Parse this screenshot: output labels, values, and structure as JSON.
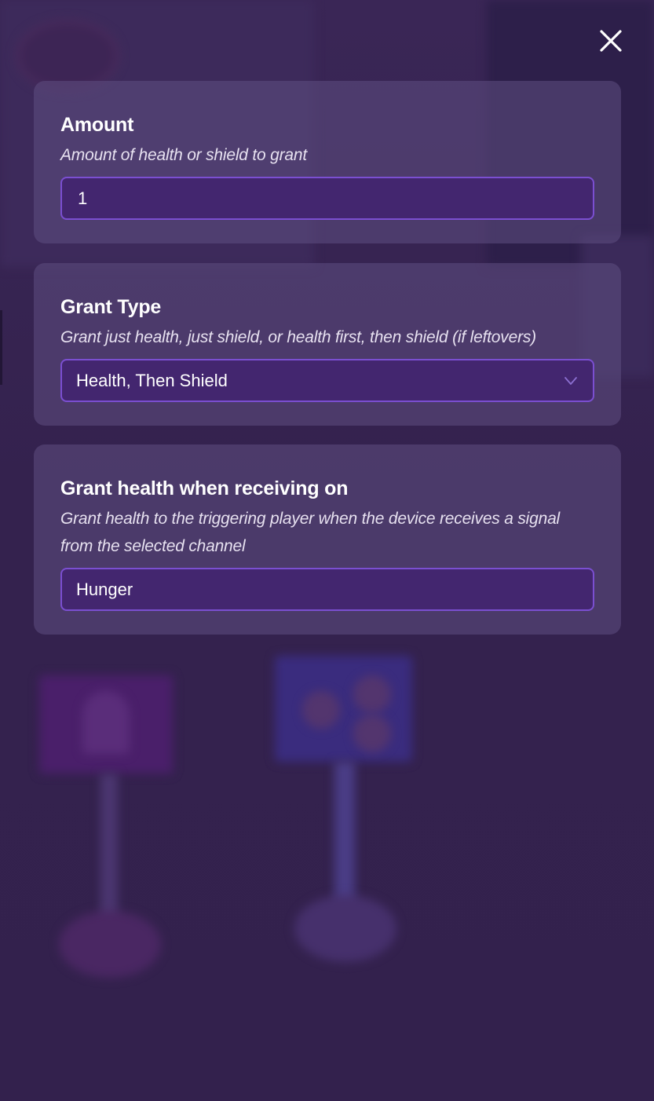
{
  "modal": {
    "close_icon": "close-icon"
  },
  "fields": {
    "amount": {
      "title": "Amount",
      "description": "Amount of health or shield to grant",
      "value": "1"
    },
    "grant_type": {
      "title": "Grant Type",
      "description": "Grant just health, just shield, or health first, then shield (if leftovers)",
      "selected": "Health, Then Shield",
      "icon": "chevron-down-icon"
    },
    "receive_channel": {
      "title": "Grant health when receiving on",
      "description": "Grant health to the triggering player when the device receives a signal from the selected channel",
      "value": "Hunger"
    }
  },
  "colors": {
    "card_bg": "#5f4e82",
    "input_bg": "#43266f",
    "input_border": "#7b4fd1",
    "page_bg": "#35224f"
  }
}
